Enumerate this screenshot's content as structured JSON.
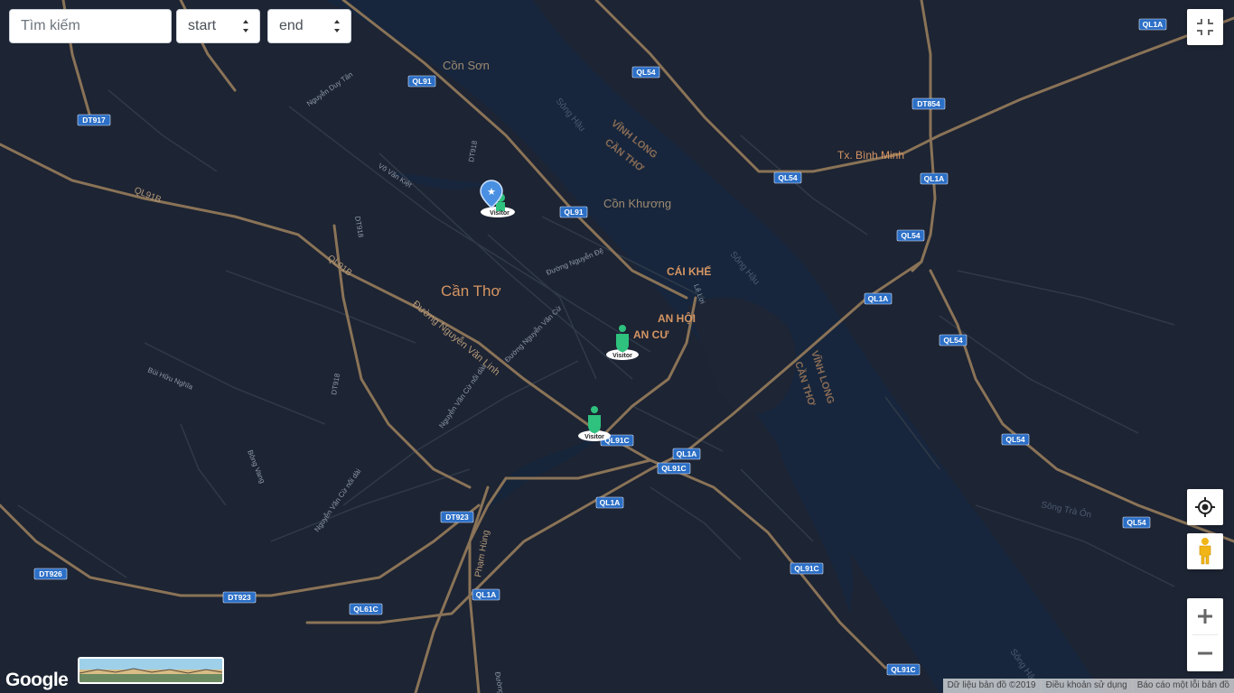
{
  "search": {
    "placeholder": "Tìm kiếm"
  },
  "start_select": {
    "value": "start"
  },
  "end_select": {
    "value": "end"
  },
  "place_labels": {
    "con_son": "Cồn Sơn",
    "con_khuong": "Cồn Khương",
    "can_tho": "Cần Thơ",
    "cai_khe": "CÁI KHẾ",
    "an_hoi": "AN HỘI",
    "an_cu": "AN CƯ",
    "binh_minh": "Tx. Bình Minh",
    "vinh_long_1": "VĨNH LONG",
    "can_tho_1": "CẦN THƠ",
    "vinh_long_2": "VĨNH LONG",
    "can_tho_2": "CẦN THƠ",
    "song_hau_1": "Sông Hậu",
    "song_hau_2": "Sông Hậu",
    "song_hau_3": "Sông Hậu",
    "song_tra_on": "Sông Trà Ôn"
  },
  "street_labels": {
    "nguyen_duy_tan": "Nguyễn Duy Tân",
    "vo_van_kiet": "Võ Văn Kiệt",
    "duong_nguyen_de": "Đường Nguyễn Đệ",
    "duong_nguyen_van_linh": "Đường Nguyễn Văn Linh",
    "duong_nguyen_van_cu": "Đường Nguyễn Văn Cừ",
    "nguyen_van_cu_noi_dai_1": "Nguyễn Văn Cừ nối dài",
    "nguyen_van_cu_noi_dai_2": "Nguyễn Văn Cừ nối dài",
    "bui_huu_nghia": "Bùi Hữu Nghĩa",
    "bong_vang": "Bông Vang",
    "pham_hung": "Phạm Hùng",
    "le_loi": "Lê Lợi",
    "ql91b_1": "QL91B",
    "ql91b_2": "QL91B",
    "dt918_1": "DT918",
    "dt918_2": "DT918",
    "dt918_3": "DT918",
    "duong": "Đường"
  },
  "shields": [
    "QL1A",
    "QL54",
    "QL91",
    "DT917",
    "DT854",
    "QL54",
    "QL1A",
    "QL91",
    "QL54",
    "QL1A",
    "QL54",
    "QL54",
    "QL1A",
    "QL91C",
    "QL91C",
    "QL1A",
    "DT923",
    "QL54",
    "DT926",
    "QL91C",
    "DT923",
    "QL1A",
    "QL61C",
    "QL91C"
  ],
  "markers": [
    {
      "label": "Visitor",
      "type": "star"
    },
    {
      "label": "Visitor",
      "type": "person"
    },
    {
      "label": "Visitor",
      "type": "person"
    }
  ],
  "footer": {
    "map_data": "Dữ liệu bản đồ ©2019",
    "terms": "Điều khoản sử dụng",
    "report": "Báo cáo một lỗi bản đồ"
  },
  "google_logo": "Google",
  "colors": {
    "background": "#1d2433",
    "river": "#17263c",
    "road_major": "#8a7357",
    "road_minor": "#2f3948",
    "place_label": "#d59563",
    "shield": "#2c6fc6",
    "marker_green": "#2ec27e"
  },
  "icons": {
    "fullscreen": "fullscreen-exit-icon",
    "locate": "my-location-icon",
    "pegman": "pegman-icon",
    "zoom_in": "plus-icon",
    "zoom_out": "minus-icon"
  }
}
